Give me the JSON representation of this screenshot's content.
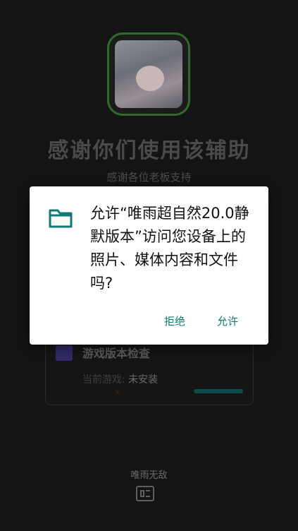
{
  "app": {
    "title": "感谢你们使用该辅助",
    "subtitle": "感谢各位老板支持",
    "card": {
      "title": "游戏版本检查",
      "status_label": "当前游戏:",
      "status_value": "未安装"
    },
    "footer_text": "唯雨无敌",
    "footer_icon": "app-grid-icon"
  },
  "dialog": {
    "message": "允许“唯雨超自然20.0静默版本”访问您设备上的照片、媒体内容和文件吗?",
    "icon": "folder-icon",
    "deny_label": "拒绝",
    "allow_label": "允许"
  },
  "colors": {
    "accent": "#0f7a73",
    "dialog_bg": "#ffffff",
    "backdrop": "#0f0f0f"
  }
}
